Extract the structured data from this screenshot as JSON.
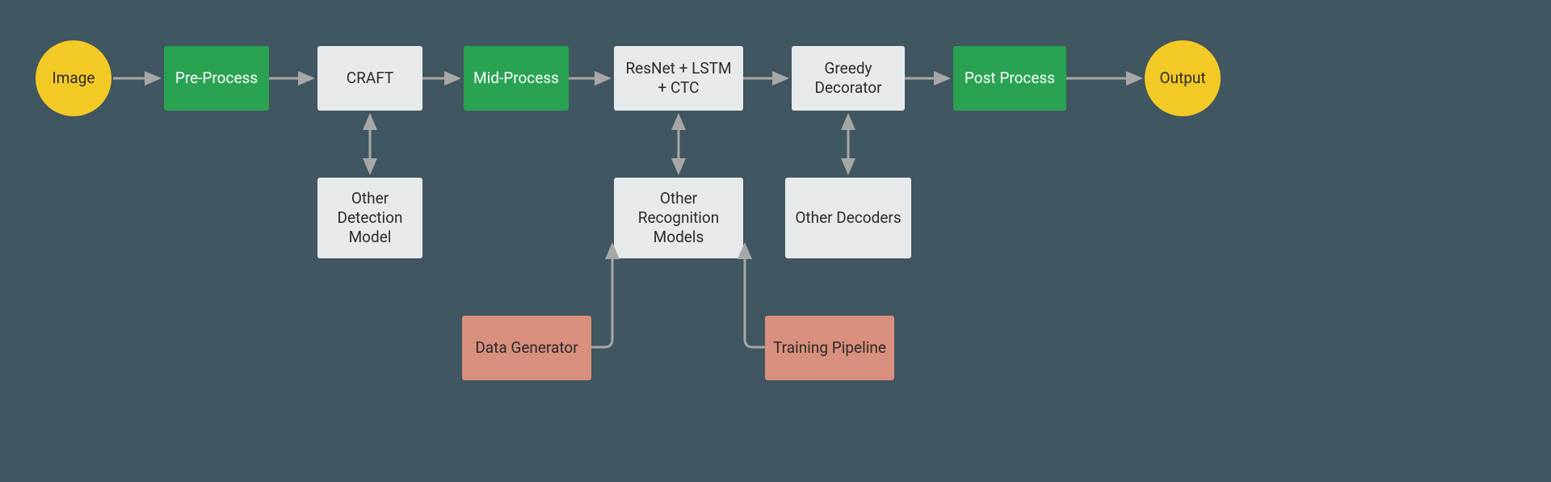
{
  "nodes": {
    "image": "Image",
    "preprocess": "Pre-Process",
    "craft": "CRAFT",
    "midprocess": "Mid-Process",
    "resnet": "ResNet + LSTM + CTC",
    "greedy": "Greedy Decorator",
    "postprocess": "Post Process",
    "output": "Output",
    "otherdetect": "Other Detection Model",
    "otherrecog": "Other Recognition Models",
    "otherdecode": "Other Decoders",
    "datagen": "Data Generator",
    "trainpipe": "Training Pipeline"
  },
  "colors": {
    "background": "#405660",
    "yellow": "#f3c925",
    "green": "#29a352",
    "gray": "#e8e9eb",
    "salmon": "#d98f7d",
    "arrow": "#a7a7a7"
  }
}
